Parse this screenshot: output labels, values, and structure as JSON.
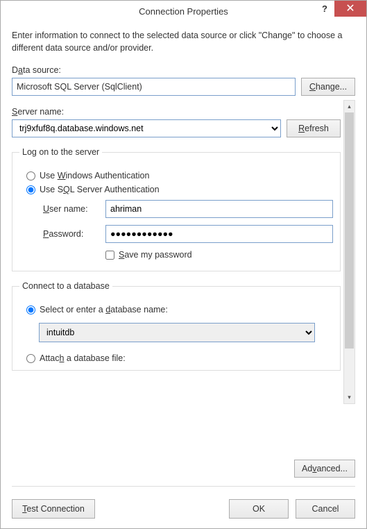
{
  "titlebar": {
    "title": "Connection Properties"
  },
  "intro": "Enter information to connect to the selected data source or click \"Change\" to choose a different data source and/or provider.",
  "dataSource": {
    "label_pre": "D",
    "label_u": "a",
    "label_post": "ta source:",
    "value": "Microsoft SQL Server (SqlClient)",
    "changeBtn_u": "C",
    "changeBtn_post": "hange..."
  },
  "serverName": {
    "label_u": "S",
    "label_post": "erver name:",
    "value": "trj9xfuf8q.database.windows.net",
    "refresh_u": "R",
    "refresh_post": "efresh"
  },
  "logon": {
    "legend": "Log on to the server",
    "winAuth_pre": "Use ",
    "winAuth_u": "W",
    "winAuth_post": "indows Authentication",
    "sqlAuth_pre": "Use S",
    "sqlAuth_u": "Q",
    "sqlAuth_post": "L Server Authentication",
    "userLabel_u": "U",
    "userLabel_post": "ser name:",
    "user": "ahriman",
    "passLabel_u": "P",
    "passLabel_post": "assword:",
    "pass": "●●●●●●●●●●●●",
    "savePass_u": "S",
    "savePass_post": "ave my password"
  },
  "db": {
    "legend": "Connect to a database",
    "selectLabel_pre": "Select or enter a ",
    "selectLabel_u": "d",
    "selectLabel_post": "atabase name:",
    "name": "intuitdb",
    "attachLabel_pre": "Attac",
    "attachLabel_u": "h",
    "attachLabel_post": " a database file:"
  },
  "advanced": {
    "btn_pre": "Ad",
    "btn_u": "v",
    "btn_post": "anced..."
  },
  "footer": {
    "test_u": "T",
    "test_post": "est Connection",
    "ok": "OK",
    "cancel": "Cancel"
  }
}
